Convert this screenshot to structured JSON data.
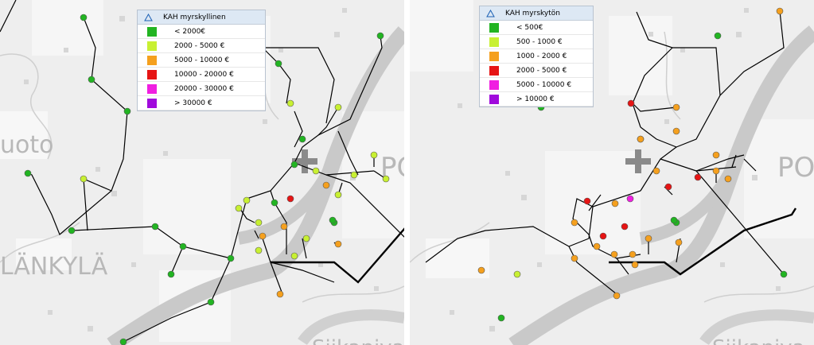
{
  "maps": [
    {
      "id": "left",
      "legend": {
        "title": "KAH myrskyllinen",
        "classes": [
          {
            "label": "< 2000€",
            "color": "#22b422"
          },
          {
            "label": "2000 - 5000 €",
            "color": "#c8f032"
          },
          {
            "label": "5000 - 10000 €",
            "color": "#f5a01e"
          },
          {
            "label": "10000 - 20000 €",
            "color": "#e61414"
          },
          {
            "label": "20000 - 30000 €",
            "color": "#f01ee1"
          },
          {
            "label": "> 30000 €",
            "color": "#a00adc"
          }
        ]
      },
      "place_labels": [
        "uoto",
        "LÄNKYLÄ",
        "PO",
        "Siikaniva"
      ]
    },
    {
      "id": "right",
      "legend": {
        "title": "KAH myrskytön",
        "classes": [
          {
            "label": "< 500€",
            "color": "#22b422"
          },
          {
            "label": "500 - 1000 €",
            "color": "#c8f032"
          },
          {
            "label": "1000 - 2000 €",
            "color": "#f5a01e"
          },
          {
            "label": "2000 - 5000 €",
            "color": "#e61414"
          },
          {
            "label": "5000 - 10000 €",
            "color": "#f01ee1"
          },
          {
            "label": "> 10000 €",
            "color": "#a00adc"
          }
        ]
      },
      "place_labels": [
        "PO",
        "Siikaniva"
      ]
    }
  ]
}
